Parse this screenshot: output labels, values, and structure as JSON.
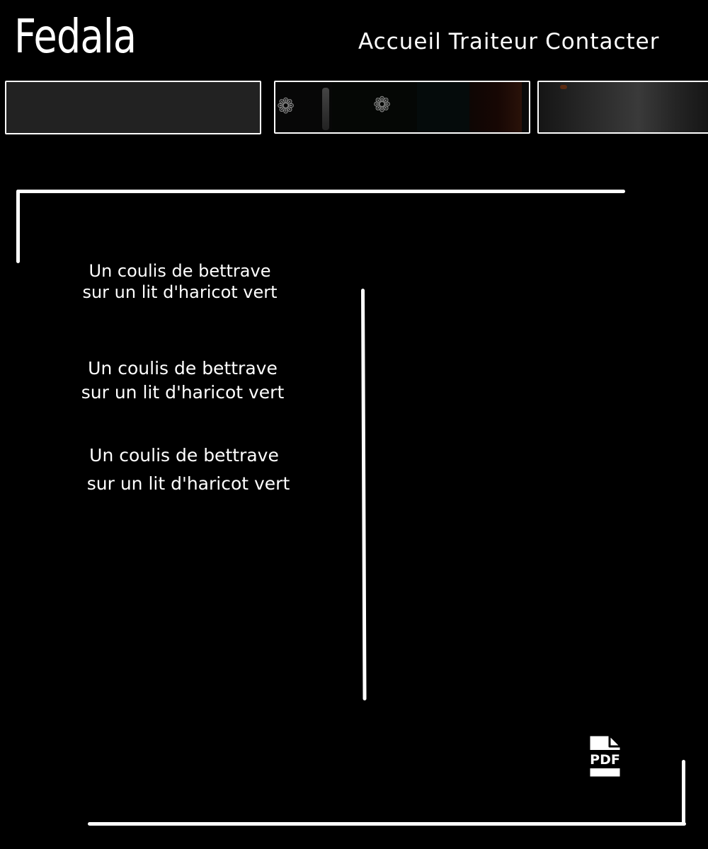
{
  "brand": {
    "logo": "Fedala"
  },
  "nav": {
    "items": [
      "Accueil",
      "Traiteur",
      "Contacter"
    ]
  },
  "gallery": {
    "thumbnails": [
      {
        "name": "thumbnail-1"
      },
      {
        "name": "thumbnail-2"
      },
      {
        "name": "thumbnail-3"
      }
    ]
  },
  "dishes": [
    {
      "line1": "Un coulis de bettrave",
      "line2": "sur un lit d'haricot vert"
    },
    {
      "line1": "Un coulis de bettrave",
      "line2": "sur un lit d'haricot vert"
    },
    {
      "line1": "Un coulis de bettrave",
      "line2": "sur un lit d'haricot vert"
    }
  ],
  "download": {
    "icon": "pdf-icon",
    "label": "PDF"
  },
  "colors": {
    "background": "#000000",
    "foreground": "#ffffff"
  }
}
